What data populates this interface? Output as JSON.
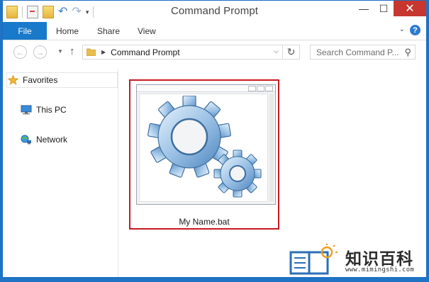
{
  "window": {
    "title": "Command Prompt",
    "minimize": "—",
    "maximize": "☐",
    "close": "✕"
  },
  "ribbon": {
    "file": "File",
    "tabs": [
      "Home",
      "Share",
      "View"
    ],
    "help": "?"
  },
  "nav": {
    "back": "←",
    "forward": "→",
    "up": "↑",
    "refresh": "↻",
    "path": "Command Prompt",
    "chevron": "▶",
    "dropdown": "⌵"
  },
  "search": {
    "placeholder": "Search Command P...",
    "icon": "⚲"
  },
  "sidebar": {
    "items": [
      {
        "label": "Favorites",
        "icon": "star-icon"
      },
      {
        "label": "This PC",
        "icon": "computer-icon"
      },
      {
        "label": "Network",
        "icon": "network-icon"
      }
    ]
  },
  "file": {
    "name": "My Name.bat",
    "icon": "batch-file-gears-icon"
  },
  "watermark": {
    "brand": "知识百科",
    "url": "www.mimingshi.com"
  },
  "colors": {
    "accent": "#1979ca",
    "selection": "#c8191e",
    "close": "#c7372f"
  }
}
